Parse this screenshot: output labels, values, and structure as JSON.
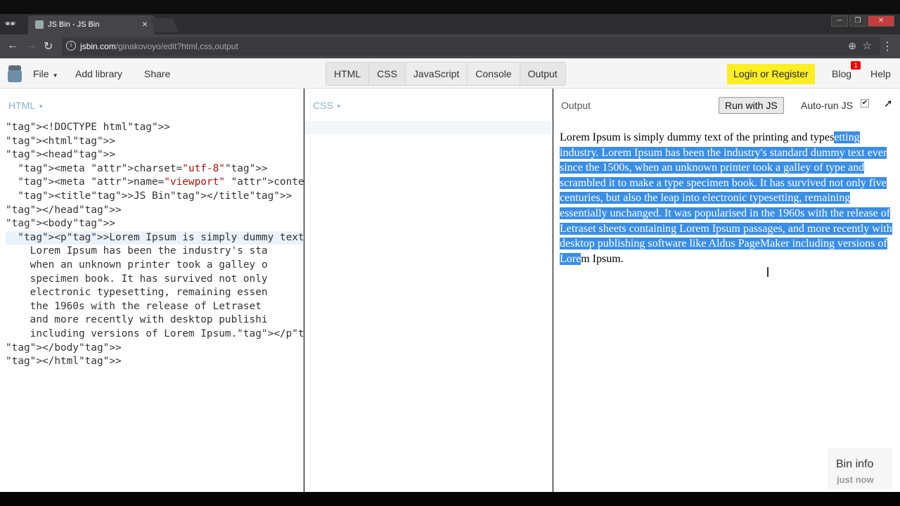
{
  "browser": {
    "tab_title": "JS Bin - JS Bin",
    "url_host": "jsbin.com",
    "url_path": "/ginakovoyo/edit?html,css,output"
  },
  "toolbar": {
    "file": "File",
    "add_library": "Add library",
    "share": "Share",
    "panels": [
      "HTML",
      "CSS",
      "JavaScript",
      "Console",
      "Output"
    ],
    "login": "Login or Register",
    "blog": "Blog",
    "blog_badge": "1",
    "help": "Help"
  },
  "html_panel": {
    "label": "HTML",
    "lines": [
      "<!DOCTYPE html>",
      "<html>",
      "<head>",
      "  <meta charset=\"utf-8\">",
      "  <meta name=\"viewport\" content=\"width=devi",
      "  <title>JS Bin</title>",
      "</head>",
      "<body>",
      "  <p>Lorem Ipsum is simply dummy text of th",
      "    Lorem Ipsum has been the industry's sta",
      "    when an unknown printer took a galley o",
      "    specimen book. It has survived not only",
      "    electronic typesetting, remaining essen",
      "    the 1960s with the release of Letraset ",
      "    and more recently with desktop publishi",
      "    including versions of Lorem Ipsum.</p>",
      "</body>",
      "</html>"
    ]
  },
  "css_panel": {
    "label": "CSS"
  },
  "output_panel": {
    "label": "Output",
    "run_button": "Run with JS",
    "autorun_label": "Auto-run JS",
    "autorun_checked": "✔",
    "text_unselected_start": "Lorem Ipsum is simply dummy text of the printing and types",
    "text_selected": "etting industry. Lorem Ipsum has been the industry's standard dummy text ever since the 1500s, when an unknown printer took a galley of type and scrambled it to make a type specimen book. It has survived not only five centuries, but also the leap into electronic typesetting, remaining essentially unchanged. It was popularised in the 1960s with the release of Letraset sheets containing Lorem Ipsum passages, and more recently with desktop publishing software like Aldus PageMaker including versions of Lore",
    "text_unselected_end": "m Ipsum."
  },
  "bin_info": {
    "title": "Bin info",
    "time": "just now"
  },
  "colors": {
    "selection": "#3a8ee6",
    "login_bg": "#ffee22",
    "panel_label": "#8ab0d8"
  }
}
